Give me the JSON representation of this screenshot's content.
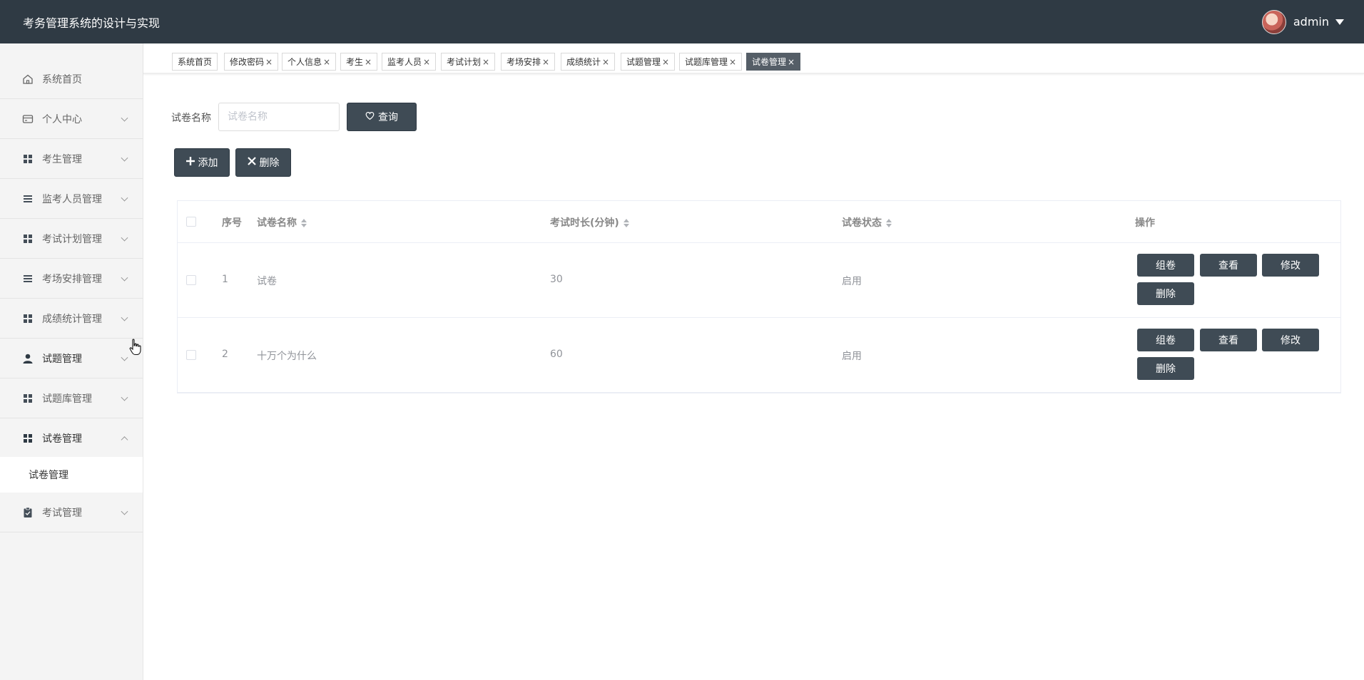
{
  "header": {
    "title": "考务管理系统的设计与实现",
    "username": "admin"
  },
  "sidebar": {
    "items": [
      {
        "label": "系统首页",
        "icon": "home-icon"
      },
      {
        "label": "个人中心",
        "icon": "wallet-icon"
      },
      {
        "label": "考生管理",
        "icon": "grid-icon"
      },
      {
        "label": "监考人员管理",
        "icon": "list-icon"
      },
      {
        "label": "考试计划管理",
        "icon": "grid-icon"
      },
      {
        "label": "考场安排管理",
        "icon": "list-icon"
      },
      {
        "label": "成绩统计管理",
        "icon": "grid-icon"
      },
      {
        "label": "试题管理",
        "icon": "user-icon"
      },
      {
        "label": "试题库管理",
        "icon": "grid-icon"
      },
      {
        "label": "试卷管理",
        "icon": "grid-icon"
      },
      {
        "label": "考试管理",
        "icon": "clipboard-icon"
      }
    ],
    "sub_item": "试卷管理"
  },
  "tabs": [
    {
      "label": "系统首页"
    },
    {
      "label": "修改密码"
    },
    {
      "label": "个人信息"
    },
    {
      "label": "考生"
    },
    {
      "label": "监考人员"
    },
    {
      "label": "考试计划"
    },
    {
      "label": "考场安排"
    },
    {
      "label": "成绩统计"
    },
    {
      "label": "试题管理"
    },
    {
      "label": "试题库管理"
    },
    {
      "label": "试卷管理"
    }
  ],
  "tab_close": "×",
  "search": {
    "label": "试卷名称",
    "placeholder": "试卷名称",
    "value": "",
    "button": "查询"
  },
  "actions": {
    "add": "添加",
    "delete": "删除"
  },
  "table": {
    "headers": {
      "index": "序号",
      "name": "试卷名称",
      "duration": "考试时长(分钟)",
      "status": "试卷状态",
      "ops": "操作"
    },
    "rows": [
      {
        "index": "1",
        "name": "试卷",
        "duration": "30",
        "status": "启用"
      },
      {
        "index": "2",
        "name": "十万个为什么",
        "duration": "60",
        "status": "启用"
      }
    ],
    "op_labels": {
      "compose": "组卷",
      "view": "查看",
      "edit": "修改",
      "delete": "删除"
    }
  },
  "colors": {
    "header_bg": "#2f3a44",
    "button_bg": "#3f4b55",
    "active_tab_bg": "#555e67"
  }
}
